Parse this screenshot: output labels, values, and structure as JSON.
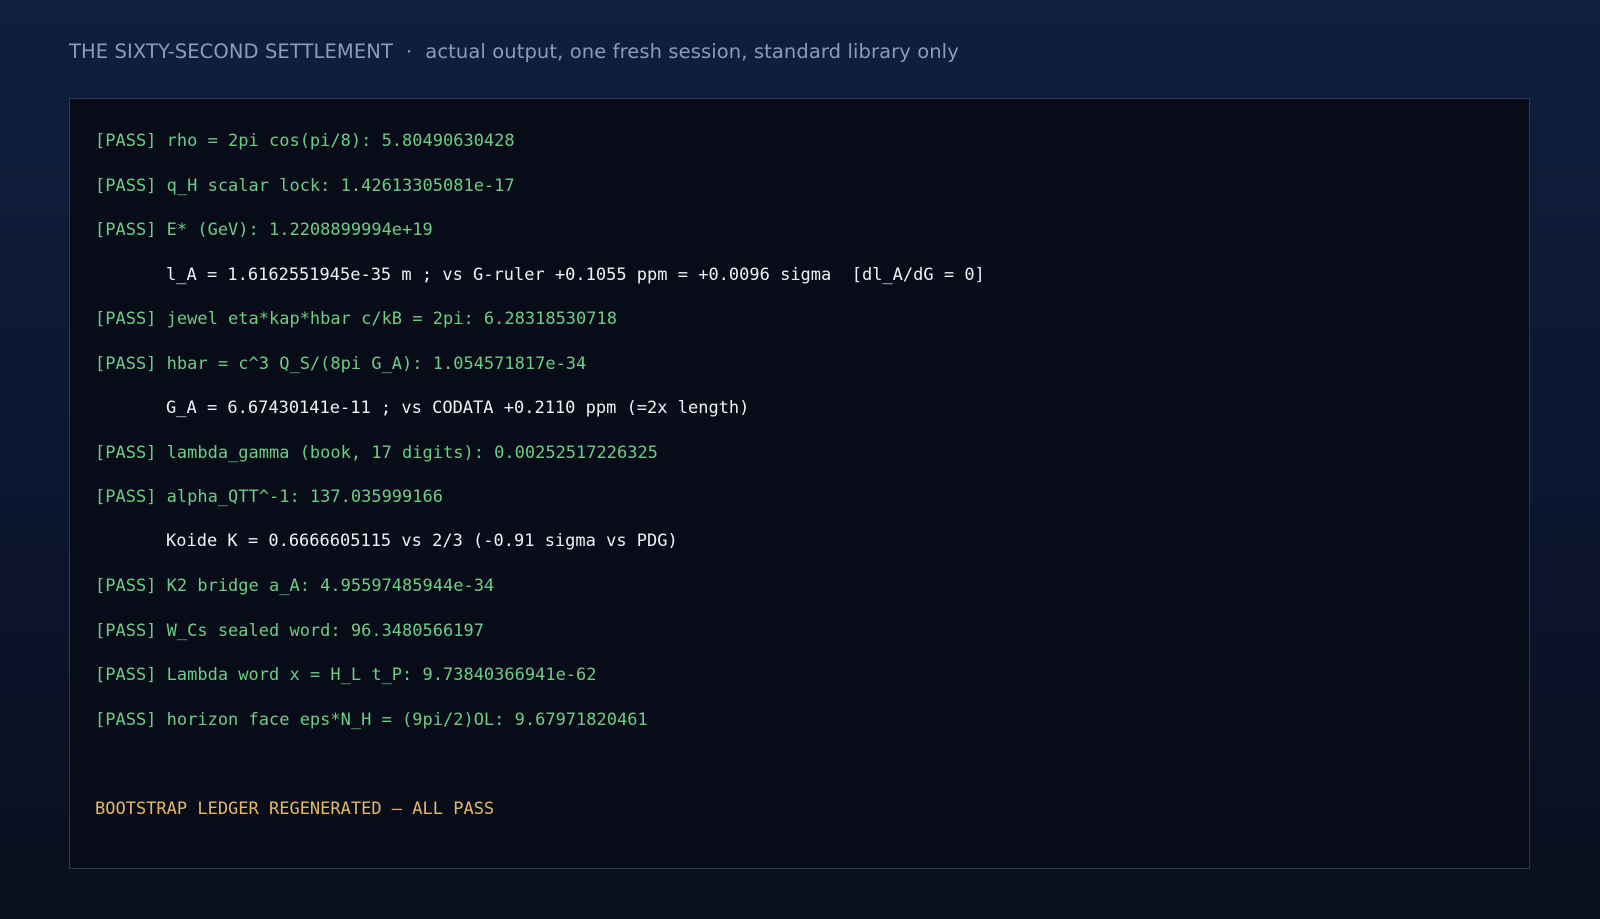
{
  "header": {
    "title": "THE SIXTY-SECOND SETTLEMENT",
    "separator": "·",
    "subtitle": "actual output, one fresh session, standard library only"
  },
  "terminal": {
    "lines": [
      {
        "kind": "pass",
        "text": "[PASS] rho = 2pi cos(pi/8): 5.80490630428"
      },
      {
        "kind": "pass",
        "text": "[PASS] q_H scalar lock: 1.42613305081e-17"
      },
      {
        "kind": "pass",
        "text": "[PASS] E* (GeV): 1.2208899994e+19"
      },
      {
        "kind": "info",
        "text": "l_A = 1.6162551945e-35 m ; vs G-ruler +0.1055 ppm = +0.0096 sigma  [dl_A/dG = 0]"
      },
      {
        "kind": "pass",
        "text": "[PASS] jewel eta*kap*hbar c/kB = 2pi: 6.28318530718"
      },
      {
        "kind": "pass",
        "text": "[PASS] hbar = c^3 Q_S/(8pi G_A): 1.054571817e-34"
      },
      {
        "kind": "info",
        "text": "G_A = 6.67430141e-11 ; vs CODATA +0.2110 ppm (=2x length)"
      },
      {
        "kind": "pass",
        "text": "[PASS] lambda_gamma (book, 17 digits): 0.00252517226325"
      },
      {
        "kind": "pass",
        "text": "[PASS] alpha_QTT^-1: 137.035999166"
      },
      {
        "kind": "info",
        "text": "Koide K = 0.6666605115 vs 2/3 (-0.91 sigma vs PDG)"
      },
      {
        "kind": "pass",
        "text": "[PASS] K2 bridge a_A: 4.95597485944e-34"
      },
      {
        "kind": "pass",
        "text": "[PASS] W_Cs sealed word: 96.3480566197"
      },
      {
        "kind": "pass",
        "text": "[PASS] Lambda word x = H_L t_P: 9.73840366941e-62"
      },
      {
        "kind": "pass",
        "text": "[PASS] horizon face eps*N_H = (9pi/2)OL: 9.67971820461"
      }
    ],
    "final": "BOOTSTRAP LEDGER REGENERATED — ALL PASS"
  },
  "colors": {
    "pass": "#6dcd85",
    "info": "#eef1f7",
    "final": "#e6b866",
    "header": "#8c9bbd",
    "terminal_bg": "#070c18",
    "border": "#2b3858"
  }
}
